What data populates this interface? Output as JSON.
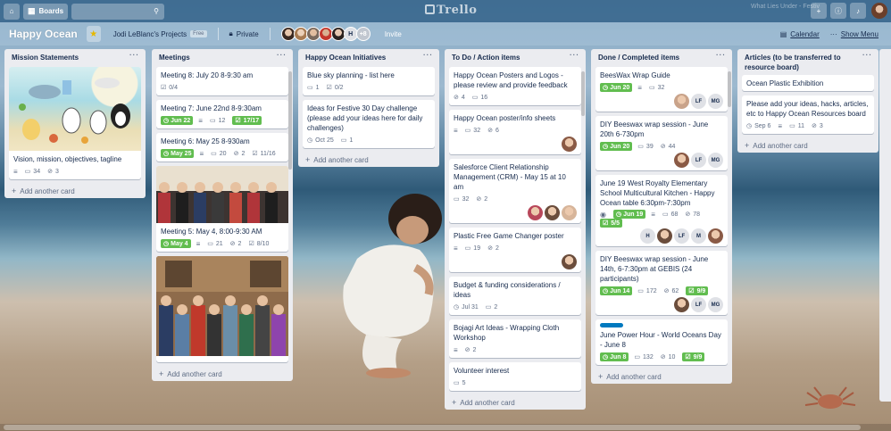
{
  "nav": {
    "boards_label": "Boards",
    "logo": "Trello",
    "ghost_text": "What Lies Under - Festiv"
  },
  "board": {
    "title": "Happy Ocean",
    "team": "Jodi LeBlanc's Projects",
    "team_badge": "Free",
    "visibility": "Private",
    "member_count_more": "+8",
    "member_initial": "H",
    "invite": "Invite",
    "calendar": "Calendar",
    "show_menu": "Show Menu"
  },
  "add_card_label": "Add another card",
  "lists": [
    {
      "title": "Mission Statements",
      "cards": [
        {
          "cover": "mission",
          "title": "Vision, mission, objectives, tagline",
          "badges": [
            {
              "type": "desc"
            },
            {
              "type": "comments",
              "value": "34"
            },
            {
              "type": "attach",
              "value": "3"
            }
          ]
        }
      ]
    },
    {
      "title": "Meetings",
      "cards": [
        {
          "title": "Meeting 8: July 20 8-9:30 am",
          "badges": [
            {
              "type": "check",
              "value": "0/4"
            }
          ]
        },
        {
          "title": "Meeting 7: June 22nd 8-9:30am",
          "badges": [
            {
              "type": "due",
              "value": "Jun 22"
            },
            {
              "type": "desc"
            },
            {
              "type": "comments",
              "value": "12"
            },
            {
              "type": "checkdone",
              "value": "17/17"
            }
          ]
        },
        {
          "title": "Meeting 6: May 25 8-930am",
          "badges": [
            {
              "type": "due",
              "value": "May 25"
            },
            {
              "type": "desc"
            },
            {
              "type": "comments",
              "value": "20"
            },
            {
              "type": "attach",
              "value": "2"
            },
            {
              "type": "check",
              "value": "11/16"
            }
          ]
        },
        {
          "cover": "photo1",
          "title": "Meeting 5: May 4, 8:00-9:30 AM",
          "badges": [
            {
              "type": "due",
              "value": "May 4"
            },
            {
              "type": "desc"
            },
            {
              "type": "comments",
              "value": "21"
            },
            {
              "type": "attach",
              "value": "2"
            },
            {
              "type": "check",
              "value": "8/10"
            }
          ]
        },
        {
          "cover": "photo2",
          "title": "",
          "badges": []
        }
      ]
    },
    {
      "title": "Happy Ocean Initiatives",
      "cards": [
        {
          "title": "Blue sky planning - list here",
          "badges": [
            {
              "type": "comments",
              "value": "1"
            },
            {
              "type": "check",
              "value": "0/2"
            }
          ]
        },
        {
          "title": "Ideas for Festive 30 Day challenge (please add your ideas here for daily challenges)",
          "badges": [
            {
              "type": "date",
              "value": "Oct 25"
            },
            {
              "type": "comments",
              "value": "1"
            }
          ]
        }
      ]
    },
    {
      "title": "To Do / Action items",
      "cards": [
        {
          "title": "Happy Ocean Posters and Logos - please review and provide feedback",
          "badges": [
            {
              "type": "attach",
              "value": "4"
            },
            {
              "type": "comments",
              "value": "16"
            }
          ]
        },
        {
          "title": "Happy Ocean poster/info sheets",
          "badges": [
            {
              "type": "desc"
            },
            {
              "type": "comments",
              "value": "32"
            },
            {
              "type": "attach",
              "value": "6"
            }
          ],
          "members": [
            "av"
          ]
        },
        {
          "title": "Salesforce Client Relationship Management (CRM) - May 15 at 10 am",
          "badges": [
            {
              "type": "comments",
              "value": "32"
            },
            {
              "type": "attach",
              "value": "2"
            }
          ],
          "members": [
            "av",
            "av",
            "av"
          ]
        },
        {
          "title": "Plastic Free Game Changer poster",
          "badges": [
            {
              "type": "desc"
            },
            {
              "type": "comments",
              "value": "19"
            },
            {
              "type": "attach",
              "value": "2"
            }
          ],
          "members": [
            "av"
          ]
        },
        {
          "title": "Budget & funding considerations / ideas",
          "badges": [
            {
              "type": "date",
              "value": "Jul 31"
            },
            {
              "type": "comments",
              "value": "2"
            }
          ]
        },
        {
          "title": "Bojagi Art Ideas - Wrapping Cloth Workshop",
          "badges": [
            {
              "type": "desc"
            },
            {
              "type": "attach",
              "value": "2"
            }
          ]
        },
        {
          "title": "Volunteer interest",
          "badges": [
            {
              "type": "comments",
              "value": "5"
            }
          ]
        }
      ]
    },
    {
      "title": "Done / Completed items",
      "cards": [
        {
          "title": "BeesWax Wrap Guide",
          "badges": [
            {
              "type": "due",
              "value": "Jun 20"
            },
            {
              "type": "desc"
            },
            {
              "type": "comments",
              "value": "32"
            }
          ],
          "members": [
            "av",
            "LF",
            "MG"
          ]
        },
        {
          "title": "DIY Beeswax wrap session - June 20th 6-730pm",
          "badges": [
            {
              "type": "due",
              "value": "Jun 20"
            },
            {
              "type": "comments",
              "value": "39"
            },
            {
              "type": "attach",
              "value": "44"
            }
          ],
          "members": [
            "av",
            "LF",
            "MG"
          ]
        },
        {
          "title": "June 19 West Royalty Elementary School Multicultural Kitchen - Happy Ocean table 6:30pm-7:30pm",
          "badges": [
            {
              "type": "watch"
            },
            {
              "type": "due",
              "value": "Jun 19"
            },
            {
              "type": "desc"
            },
            {
              "type": "comments",
              "value": "68"
            },
            {
              "type": "attach",
              "value": "78"
            },
            {
              "type": "checkdone",
              "value": "5/5"
            }
          ],
          "members": [
            "H",
            "av",
            "LF",
            "M",
            "av"
          ]
        },
        {
          "title": "DIY Beeswax wrap session - June 14th, 6-7:30pm at GEBIS (24 participants)",
          "badges": [
            {
              "type": "due",
              "value": "Jun 14"
            },
            {
              "type": "comments",
              "value": "172"
            },
            {
              "type": "attach",
              "value": "62"
            },
            {
              "type": "checkdone",
              "value": "9/9"
            }
          ],
          "members": [
            "av",
            "LF",
            "MG"
          ]
        },
        {
          "label": true,
          "title": "June Power Hour - World Oceans Day - June 8",
          "badges": [
            {
              "type": "due",
              "value": "Jun 8"
            },
            {
              "type": "comments",
              "value": "132"
            },
            {
              "type": "attach",
              "value": "10"
            },
            {
              "type": "checkdone",
              "value": "9/9"
            }
          ]
        }
      ]
    },
    {
      "title": "Articles (to be transferred to resource board)",
      "cards": [
        {
          "title": "Ocean Plastic Exhibition",
          "badges": []
        },
        {
          "title": "Please add your ideas, hacks, articles, etc to Happy Ocean Resources board",
          "badges": [
            {
              "type": "date",
              "value": "Sep 6"
            },
            {
              "type": "desc"
            },
            {
              "type": "comments",
              "value": "11"
            },
            {
              "type": "attach",
              "value": "3"
            }
          ]
        }
      ]
    }
  ],
  "colors": {
    "due_green": "#61bd4f",
    "label_blue": "#0079bf",
    "list_bg": "#ebecf0"
  }
}
